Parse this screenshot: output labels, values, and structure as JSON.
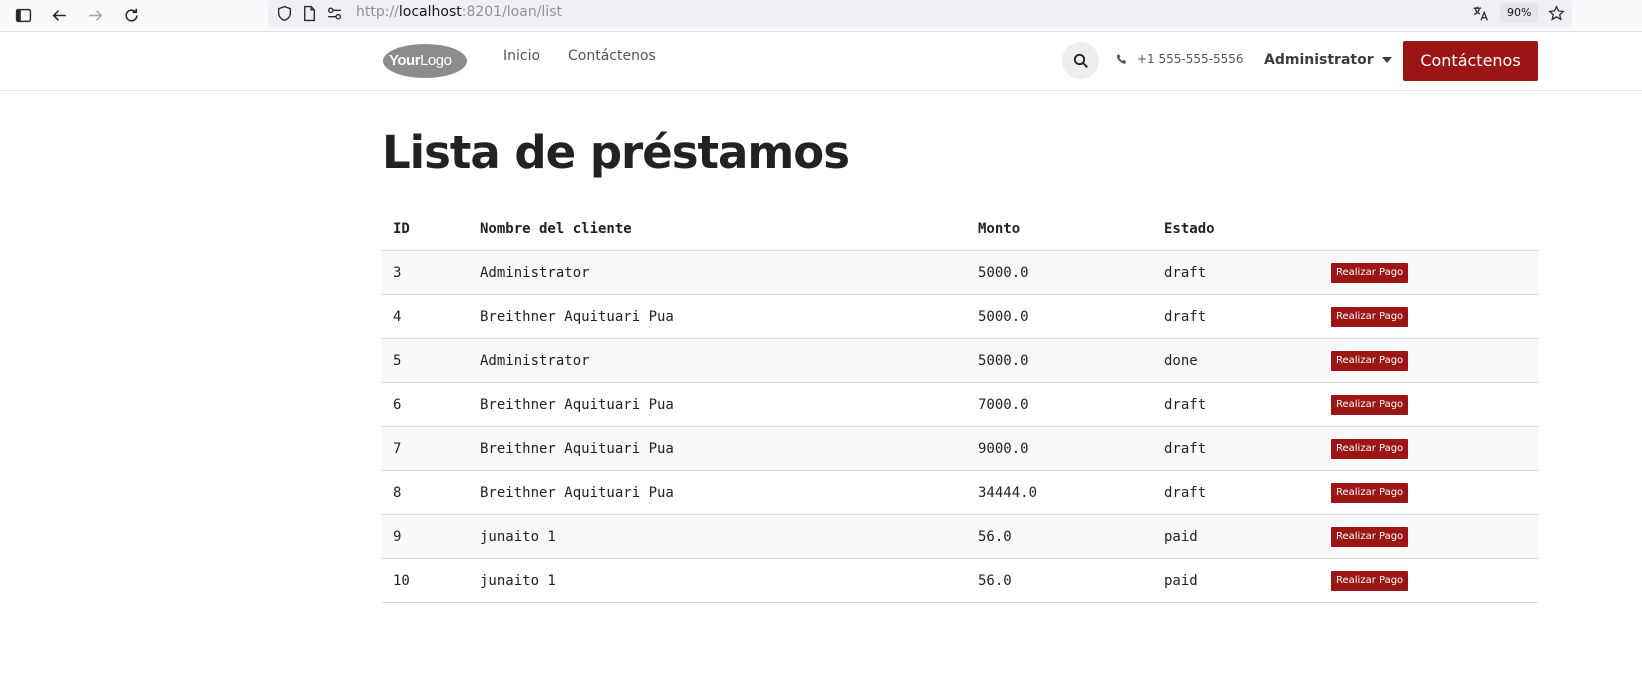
{
  "browser": {
    "url_prefix": "http://",
    "url_host": "localhost",
    "url_path": ":8201/loan/list",
    "zoom": "90%"
  },
  "header": {
    "logo_bold": "Your",
    "logo_rest": "Logo",
    "nav": [
      "Inicio",
      "Contáctenos"
    ],
    "phone": "+1 555-555-5556",
    "user": "Administrator",
    "contact_button": "Contáctenos",
    "accent": "#9b1515",
    "ribbon_color": "#714b67"
  },
  "main": {
    "title": "Lista de préstamos",
    "columns": [
      "ID",
      "Nombre del cliente",
      "Monto",
      "Estado",
      ""
    ],
    "pay_label": "Realizar Pago",
    "rows": [
      {
        "id": "3",
        "client": "Administrator",
        "amount": "5000.0",
        "state": "draft"
      },
      {
        "id": "4",
        "client": "Breithner Aquituari Pua",
        "amount": "5000.0",
        "state": "draft"
      },
      {
        "id": "5",
        "client": "Administrator",
        "amount": "5000.0",
        "state": "done"
      },
      {
        "id": "6",
        "client": "Breithner Aquituari Pua",
        "amount": "7000.0",
        "state": "draft"
      },
      {
        "id": "7",
        "client": "Breithner Aquituari Pua",
        "amount": "9000.0",
        "state": "draft"
      },
      {
        "id": "8",
        "client": "Breithner Aquituari Pua",
        "amount": "34444.0",
        "state": "draft"
      },
      {
        "id": "9",
        "client": "junaito 1",
        "amount": "56.0",
        "state": "paid"
      },
      {
        "id": "10",
        "client": "junaito 1",
        "amount": "56.0",
        "state": "paid"
      }
    ]
  }
}
